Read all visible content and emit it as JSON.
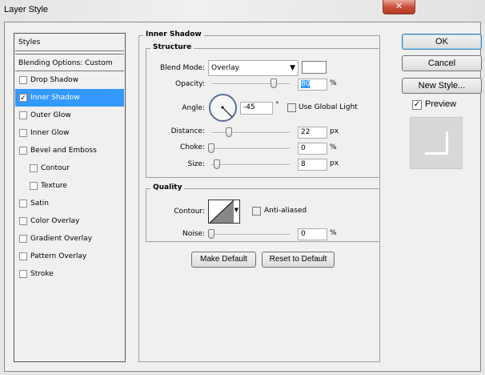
{
  "window": {
    "title": "Layer Style",
    "close_icon": "close-icon"
  },
  "styles_panel": {
    "header": "Styles",
    "blending": "Blending Options: Custom",
    "items": [
      {
        "label": "Drop Shadow",
        "checked": false
      },
      {
        "label": "Inner Shadow",
        "checked": true
      },
      {
        "label": "Outer Glow",
        "checked": false
      },
      {
        "label": "Inner Glow",
        "checked": false
      },
      {
        "label": "Bevel and Emboss",
        "checked": false
      },
      {
        "label": "Contour",
        "checked": false
      },
      {
        "label": "Texture",
        "checked": false
      },
      {
        "label": "Satin",
        "checked": false
      },
      {
        "label": "Color Overlay",
        "checked": false
      },
      {
        "label": "Gradient Overlay",
        "checked": false
      },
      {
        "label": "Pattern Overlay",
        "checked": false
      },
      {
        "label": "Stroke",
        "checked": false
      }
    ]
  },
  "inner_shadow": {
    "title": "Inner Shadow",
    "structure": {
      "title": "Structure",
      "blend_mode_label": "Blend Mode:",
      "blend_mode": "Overlay",
      "color": "#ffffff",
      "opacity_label": "Opacity:",
      "opacity": "80",
      "opacity_unit": "%",
      "opacity_fraction": 0.8,
      "angle_label": "Angle:",
      "angle": "-45",
      "angle_unit": "°",
      "global_light_label": "Use Global Light",
      "distance_label": "Distance:",
      "distance": "22",
      "distance_unit": "px",
      "choke_label": "Choke:",
      "choke": "0",
      "choke_unit": "%",
      "size_label": "Size:",
      "size": "8",
      "size_unit": "px"
    },
    "quality": {
      "title": "Quality",
      "contour_label": "Contour:",
      "anti_aliased_label": "Anti-aliased",
      "noise_label": "Noise:",
      "noise": "0",
      "noise_unit": "%"
    },
    "make_default": "Make Default",
    "reset_default": "Reset to Default"
  },
  "buttons": {
    "ok": "OK",
    "cancel": "Cancel",
    "new_style": "New Style...",
    "preview": "Preview"
  }
}
